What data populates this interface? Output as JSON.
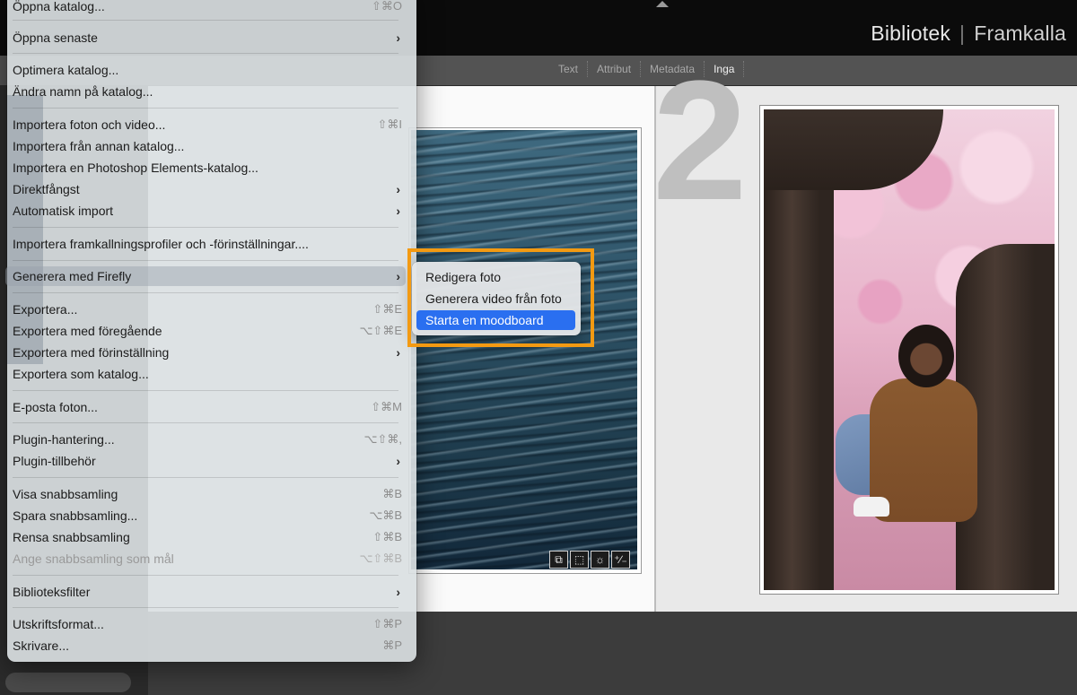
{
  "app": {
    "modules": {
      "active": "Bibliotek",
      "inactive": "Framkalla"
    },
    "toolbar": {
      "items": [
        "Text",
        "Attribut",
        "Metadata",
        "Inga"
      ],
      "active": "Inga"
    },
    "book": {
      "page_number": "2"
    },
    "photo_badges": [
      "⧉",
      "⬚",
      "☼",
      "⁺∕₋"
    ]
  },
  "menu": {
    "items": [
      {
        "label": "Öppna katalog...",
        "shortcut": "⇧⌘O"
      },
      {
        "label": "Öppna senaste",
        "submenu": true
      },
      {
        "label": "Optimera katalog..."
      },
      {
        "label": "Ändra namn på katalog..."
      },
      {
        "label": "Importera foton och video...",
        "shortcut": "⇧⌘I"
      },
      {
        "label": "Importera från annan katalog..."
      },
      {
        "label": "Importera en Photoshop Elements-katalog..."
      },
      {
        "label": "Direktfångst",
        "submenu": true
      },
      {
        "label": "Automatisk import",
        "submenu": true
      },
      {
        "label": "Importera framkallningsprofiler och -förinställningar...."
      },
      {
        "label": "Generera med Firefly",
        "submenu": true
      },
      {
        "label": "Exportera...",
        "shortcut": "⇧⌘E"
      },
      {
        "label": "Exportera med föregående",
        "shortcut": "⌥⇧⌘E"
      },
      {
        "label": "Exportera med förinställning",
        "submenu": true
      },
      {
        "label": "Exportera som katalog..."
      },
      {
        "label": "E-posta foton...",
        "shortcut": "⇧⌘M"
      },
      {
        "label": "Plugin-hantering...",
        "shortcut": "⌥⇧⌘,"
      },
      {
        "label": "Plugin-tillbehör",
        "submenu": true
      },
      {
        "label": "Visa snabbsamling",
        "shortcut": "⌘B"
      },
      {
        "label": "Spara snabbsamling...",
        "shortcut": "⌥⌘B"
      },
      {
        "label": "Rensa snabbsamling",
        "shortcut": "⇧⌘B"
      },
      {
        "label": "Ange snabbsamling som mål",
        "shortcut": "⌥⇧⌘B",
        "disabled": true
      },
      {
        "label": "Biblioteksfilter",
        "submenu": true
      },
      {
        "label": "Utskriftsformat...",
        "shortcut": "⇧⌘P"
      },
      {
        "label": "Skrivare...",
        "shortcut": "⌘P"
      }
    ],
    "highlighted_item": "Generera med Firefly"
  },
  "submenu": {
    "items": [
      {
        "label": "Redigera foto"
      },
      {
        "label": "Generera video från foto"
      },
      {
        "label": "Starta en moodboard",
        "selected": true
      }
    ]
  },
  "colors": {
    "selection_blue": "#2a6ff0",
    "callout_orange": "#f39a12",
    "menu_bg": "#dadfe2"
  },
  "icons": {
    "chevron": "chevron-right-icon",
    "collapse": "triangle-up-icon"
  }
}
